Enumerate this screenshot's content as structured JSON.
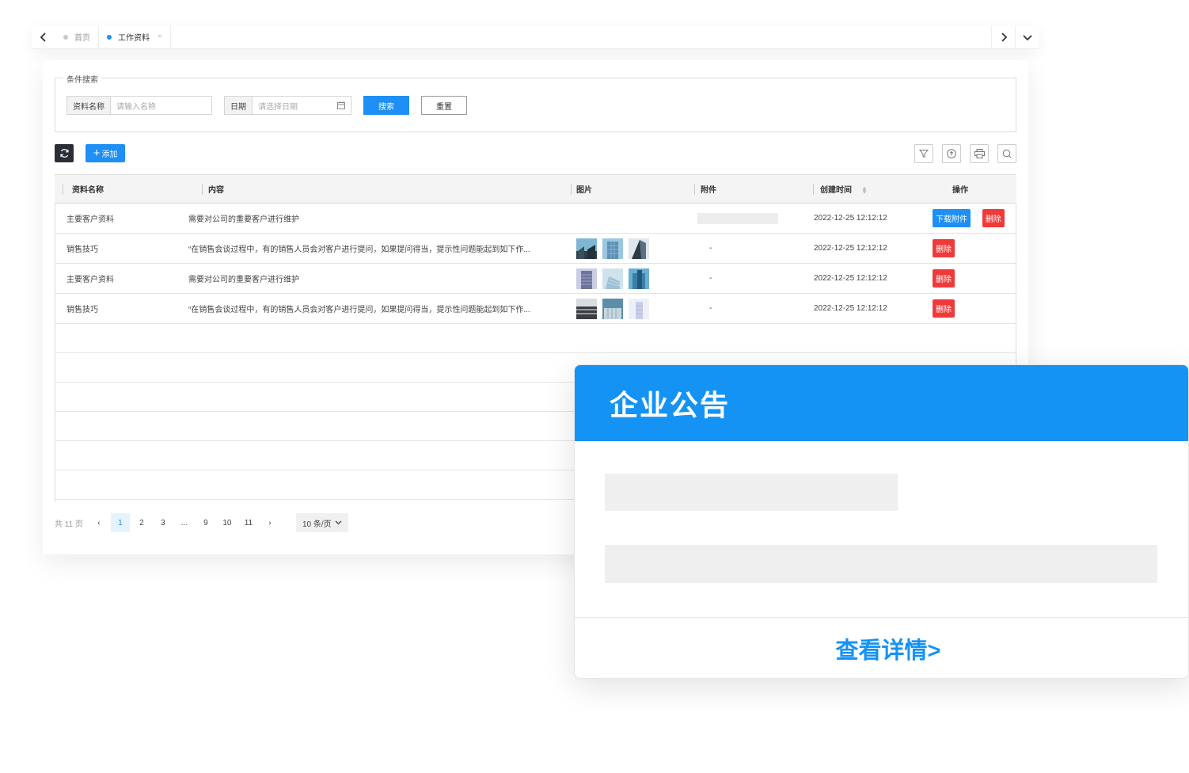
{
  "tabbar": {
    "tabs": [
      {
        "label": "首页",
        "dot_color": "#c8c8c8",
        "active": false
      },
      {
        "label": "工作资料",
        "dot_color": "#1d8ff5",
        "active": true,
        "close": "×"
      }
    ]
  },
  "search": {
    "title": "条件搜索",
    "name_label": "资料名称",
    "name_placeholder": "请输入名称",
    "date_label": "日期",
    "date_placeholder": "请选择日期",
    "search_button": "搜索",
    "reset_button": "重置"
  },
  "toolbar": {
    "add_label": "添加",
    "tool_icons": [
      "filter-icon",
      "upload-icon",
      "print-icon",
      "search-icon"
    ]
  },
  "table": {
    "headers": [
      "资料名称",
      "内容",
      "图片",
      "附件",
      "创建时间",
      "操作"
    ],
    "rows": [
      {
        "name": "主要客户资料",
        "content": "需要对公司的重要客户进行维护",
        "images": [],
        "attachment": "",
        "has_attachment_bar": true,
        "created": "2022-12-25 12:12:12",
        "download_label": "下载附件",
        "delete_label": "删除"
      },
      {
        "name": "销售技巧",
        "content": "“在销售会谈过程中，有的销售人员会对客户进行提问，如果提问得当，提示性问题能起到如下作...",
        "images": [
          "building-photo-1",
          "building-photo-2",
          "building-photo-3"
        ],
        "attachment": "-",
        "has_attachment_bar": false,
        "created": "2022-12-25 12:12:12",
        "download_label": "",
        "delete_label": "删除"
      },
      {
        "name": "主要客户资料",
        "content": "需要对公司的重要客户进行维护",
        "images": [
          "building-photo-4",
          "building-photo-5",
          "building-photo-6"
        ],
        "attachment": "-",
        "has_attachment_bar": false,
        "created": "2022-12-25 12:12:12",
        "download_label": "",
        "delete_label": "删除"
      },
      {
        "name": "销售技巧",
        "content": "“在销售会谈过程中，有的销售人员会对客户进行提问，如果提问得当，提示性问题能起到如下作...",
        "images": [
          "building-photo-7",
          "building-photo-8",
          "building-photo-9"
        ],
        "attachment": "-",
        "has_attachment_bar": false,
        "created": "2022-12-25 12:12:12",
        "download_label": "",
        "delete_label": "删除"
      }
    ],
    "empty_rows": 6
  },
  "pager": {
    "total": "共 11 页",
    "prev": "‹",
    "pages": [
      "1",
      "2",
      "3",
      "...",
      "9",
      "10",
      "11"
    ],
    "current": "1",
    "next": "›",
    "page_size": "10 条/页"
  },
  "notice": {
    "title": "企业公告",
    "link": "查看详情>"
  },
  "colors": {
    "primary": "#1d8ff5",
    "danger": "#f03a3a",
    "notice_header": "#1593f5"
  }
}
